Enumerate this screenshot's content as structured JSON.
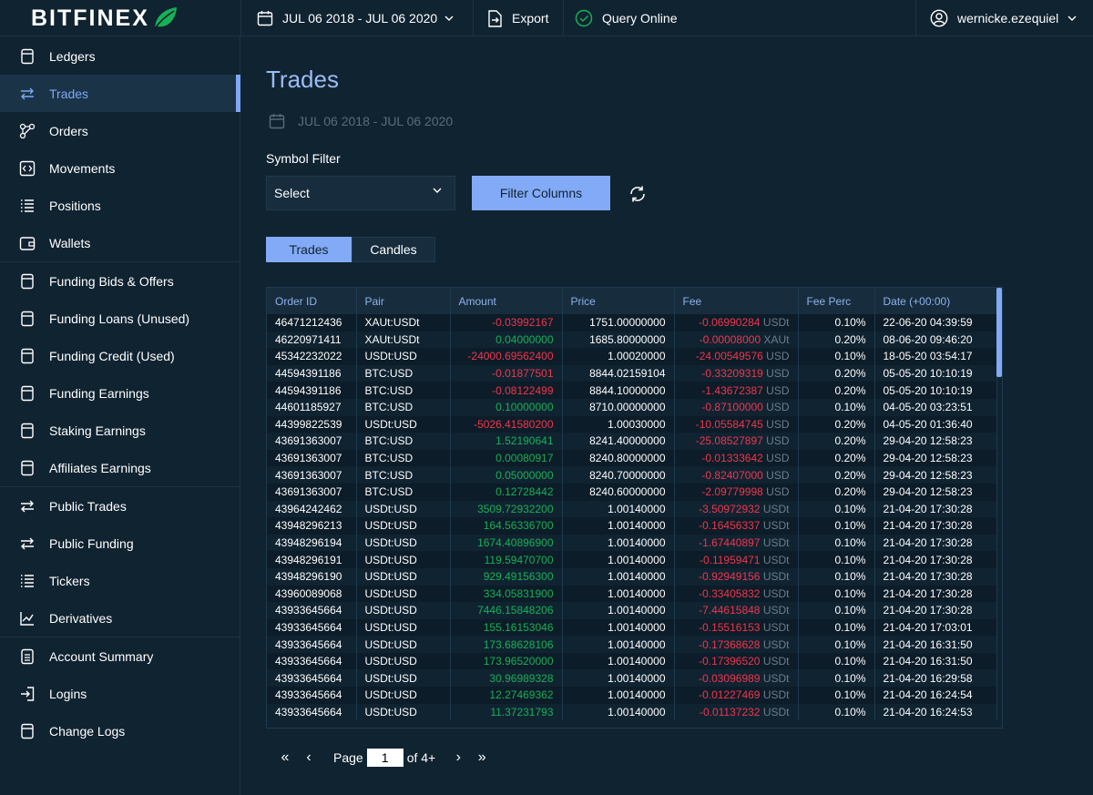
{
  "app": {
    "logo_text": "BITFINEX"
  },
  "topbar": {
    "date_range": "JUL 06 2018 - JUL 06 2020",
    "export_label": "Export",
    "query_label": "Query Online",
    "username": "wernicke.ezequiel"
  },
  "sidebar": {
    "items": [
      {
        "label": "Ledgers",
        "icon": "ledger-icon"
      },
      {
        "label": "Trades",
        "icon": "trades-icon",
        "active": true
      },
      {
        "label": "Orders",
        "icon": "orders-icon"
      },
      {
        "label": "Movements",
        "icon": "movements-icon"
      },
      {
        "label": "Positions",
        "icon": "positions-icon"
      },
      {
        "label": "Wallets",
        "icon": "wallet-icon"
      },
      {
        "label": "Funding Bids & Offers",
        "icon": "funding-icon"
      },
      {
        "label": "Funding Loans (Unused)",
        "icon": "funding-icon"
      },
      {
        "label": "Funding Credit (Used)",
        "icon": "funding-icon"
      },
      {
        "label": "Funding Earnings",
        "icon": "funding-icon"
      },
      {
        "label": "Staking Earnings",
        "icon": "funding-icon"
      },
      {
        "label": "Affiliates Earnings",
        "icon": "funding-icon"
      },
      {
        "label": "Public Trades",
        "icon": "trades-icon"
      },
      {
        "label": "Public Funding",
        "icon": "trades-icon"
      },
      {
        "label": "Tickers",
        "icon": "tickers-icon"
      },
      {
        "label": "Derivatives",
        "icon": "derivatives-icon"
      },
      {
        "label": "Account Summary",
        "icon": "summary-icon"
      },
      {
        "label": "Logins",
        "icon": "login-icon"
      },
      {
        "label": "Change Logs",
        "icon": "changelog-icon"
      }
    ]
  },
  "main": {
    "title": "Trades",
    "date_range": "JUL 06 2018 - JUL 06 2020",
    "symbol_filter_label": "Symbol Filter",
    "select_value": "Select",
    "filter_button": "Filter Columns",
    "tabs": [
      {
        "label": "Trades",
        "active": true
      },
      {
        "label": "Candles",
        "active": false
      }
    ]
  },
  "table": {
    "columns": [
      "Order ID",
      "Pair",
      "Amount",
      "Price",
      "Fee",
      "Fee Perc",
      "Date (+00:00)"
    ],
    "rows": [
      [
        "46471212436",
        "XAUt:USDt",
        "-0.03992167",
        "1751.00000000",
        "-0.06990284",
        "USDt",
        "0.10%",
        "22-06-20 04:39:59"
      ],
      [
        "46220971411",
        "XAUt:USDt",
        "0.04000000",
        "1685.80000000",
        "-0.00008000",
        "XAUt",
        "0.20%",
        "08-06-20 09:46:20"
      ],
      [
        "45342232022",
        "USDt:USD",
        "-24000.69562400",
        "1.00020000",
        "-24.00549576",
        "USD",
        "0.10%",
        "18-05-20 03:54:17"
      ],
      [
        "44594391186",
        "BTC:USD",
        "-0.01877501",
        "8844.02159104",
        "-0.33209319",
        "USD",
        "0.20%",
        "05-05-20 10:10:19"
      ],
      [
        "44594391186",
        "BTC:USD",
        "-0.08122499",
        "8844.10000000",
        "-1.43672387",
        "USD",
        "0.20%",
        "05-05-20 10:10:19"
      ],
      [
        "44601185927",
        "BTC:USD",
        "0.10000000",
        "8710.00000000",
        "-0.87100000",
        "USD",
        "0.10%",
        "04-05-20 03:23:51"
      ],
      [
        "44399822539",
        "USDt:USD",
        "-5026.41580200",
        "1.00030000",
        "-10.05584745",
        "USD",
        "0.20%",
        "04-05-20 01:36:40"
      ],
      [
        "43691363007",
        "BTC:USD",
        "1.52190641",
        "8241.40000000",
        "-25.08527897",
        "USD",
        "0.20%",
        "29-04-20 12:58:23"
      ],
      [
        "43691363007",
        "BTC:USD",
        "0.00080917",
        "8240.80000000",
        "-0.01333642",
        "USD",
        "0.20%",
        "29-04-20 12:58:23"
      ],
      [
        "43691363007",
        "BTC:USD",
        "0.05000000",
        "8240.70000000",
        "-0.82407000",
        "USD",
        "0.20%",
        "29-04-20 12:58:23"
      ],
      [
        "43691363007",
        "BTC:USD",
        "0.12728442",
        "8240.60000000",
        "-2.09779998",
        "USD",
        "0.20%",
        "29-04-20 12:58:23"
      ],
      [
        "43964242462",
        "USDt:USD",
        "3509.72932200",
        "1.00140000",
        "-3.50972932",
        "USDt",
        "0.10%",
        "21-04-20 17:30:28"
      ],
      [
        "43948296213",
        "USDt:USD",
        "164.56336700",
        "1.00140000",
        "-0.16456337",
        "USDt",
        "0.10%",
        "21-04-20 17:30:28"
      ],
      [
        "43948296194",
        "USDt:USD",
        "1674.40896900",
        "1.00140000",
        "-1.67440897",
        "USDt",
        "0.10%",
        "21-04-20 17:30:28"
      ],
      [
        "43948296191",
        "USDt:USD",
        "119.59470700",
        "1.00140000",
        "-0.11959471",
        "USDt",
        "0.10%",
        "21-04-20 17:30:28"
      ],
      [
        "43948296190",
        "USDt:USD",
        "929.49156300",
        "1.00140000",
        "-0.92949156",
        "USDt",
        "0.10%",
        "21-04-20 17:30:28"
      ],
      [
        "43960089068",
        "USDt:USD",
        "334.05831900",
        "1.00140000",
        "-0.33405832",
        "USDt",
        "0.10%",
        "21-04-20 17:30:28"
      ],
      [
        "43933645664",
        "USDt:USD",
        "7446.15848206",
        "1.00140000",
        "-7.44615848",
        "USDt",
        "0.10%",
        "21-04-20 17:30:28"
      ],
      [
        "43933645664",
        "USDt:USD",
        "155.16153046",
        "1.00140000",
        "-0.15516153",
        "USDt",
        "0.10%",
        "21-04-20 17:03:01"
      ],
      [
        "43933645664",
        "USDt:USD",
        "173.68628106",
        "1.00140000",
        "-0.17368628",
        "USDt",
        "0.10%",
        "21-04-20 16:31:50"
      ],
      [
        "43933645664",
        "USDt:USD",
        "173.96520000",
        "1.00140000",
        "-0.17396520",
        "USDt",
        "0.10%",
        "21-04-20 16:31:50"
      ],
      [
        "43933645664",
        "USDt:USD",
        "30.96989328",
        "1.00140000",
        "-0.03096989",
        "USDt",
        "0.10%",
        "21-04-20 16:29:58"
      ],
      [
        "43933645664",
        "USDt:USD",
        "12.27469362",
        "1.00140000",
        "-0.01227469",
        "USDt",
        "0.10%",
        "21-04-20 16:24:54"
      ],
      [
        "43933645664",
        "USDt:USD",
        "11.37231793",
        "1.00140000",
        "-0.01137232",
        "USDt",
        "0.10%",
        "21-04-20 16:24:53"
      ]
    ]
  },
  "pagination": {
    "first": "«",
    "prev": "‹",
    "page_label": "Page",
    "page_value": "1",
    "of_label": "of 4+",
    "next": "›",
    "last": "»"
  },
  "colors": {
    "accent": "#82aaf7",
    "background": "#102331",
    "positive": "#16b157",
    "negative": "#f0364d"
  }
}
